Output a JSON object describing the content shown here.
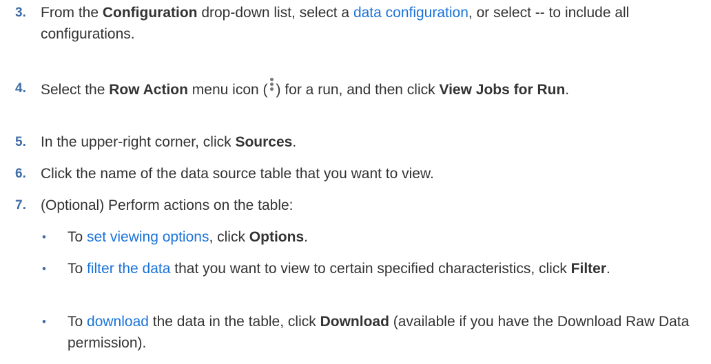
{
  "steps": [
    {
      "number": "3.",
      "t1": "From the ",
      "b1": "Configuration",
      "t2": " drop-down list, select a ",
      "link": "data configuration",
      "t3": ", or select -- to include all configurations."
    },
    {
      "number": "4.",
      "t1": "Select the ",
      "b1": "Row Action",
      "t2": " menu icon (",
      "icon": "kebab-menu-icon",
      "t3": ") for a run, and then click ",
      "b2": "View Jobs for Run",
      "t4": "."
    },
    {
      "number": "5.",
      "t1": "In the upper-right corner, click ",
      "b1": "Sources",
      "t2": "."
    },
    {
      "number": "6.",
      "t1": "Click the name of the data source table that you want to view."
    },
    {
      "number": "7.",
      "t1": "(Optional) Perform actions on the table:"
    }
  ],
  "bullets": [
    {
      "mark": "•",
      "t1": "To ",
      "link": "set viewing options",
      "t2": ", click ",
      "b1": "Options",
      "t3": "."
    },
    {
      "mark": "•",
      "t1": "To ",
      "link": "filter the data",
      "t2": " that you want to view to certain specified characteristics, click ",
      "b1": "Filter",
      "t3": "."
    },
    {
      "mark": "•",
      "t1": "To ",
      "link": "download",
      "t2": " the data in the table, click ",
      "b1": "Download",
      "t3": " (available if you have the Download Raw Data permission)."
    }
  ],
  "colors": {
    "number": "#3d6ca6",
    "link": "#1a73d9",
    "text": "#333333"
  }
}
